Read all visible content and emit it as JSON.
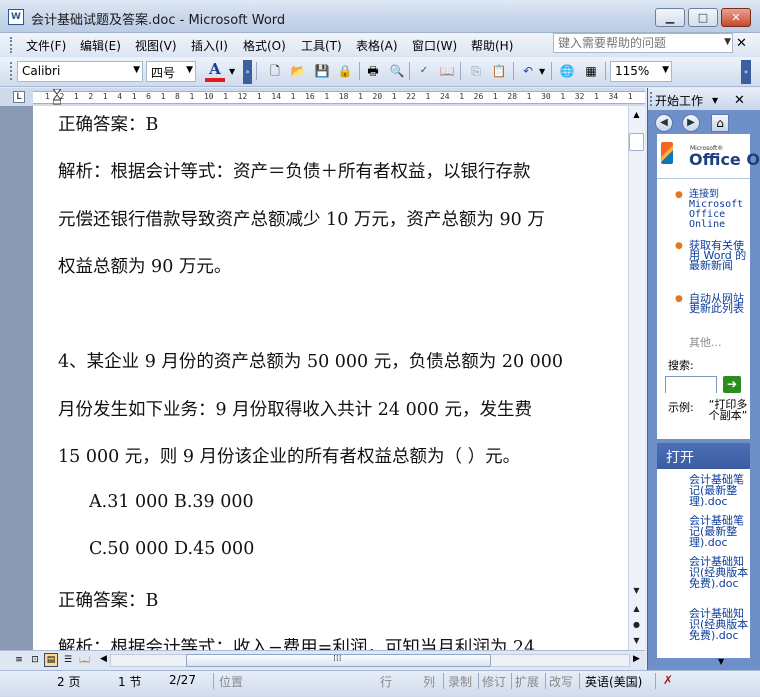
{
  "window": {
    "title": "会计基础试题及答案.doc - Microsoft Word",
    "app_icon": "W"
  },
  "menu": [
    "文件(F)",
    "编辑(E)",
    "视图(V)",
    "插入(I)",
    "格式(O)",
    "工具(T)",
    "表格(A)",
    "窗口(W)",
    "帮助(H)"
  ],
  "help_box": {
    "placeholder": "键入需要帮助的问题"
  },
  "toolbar": {
    "font_name": "Calibri",
    "font_size": "四号",
    "font_color_letter": "A",
    "font_color": "#e21b1b",
    "zoom": "115%"
  },
  "ruler": {
    "labels": "1  2  1  2  1  4  1  6  1  8  1  10  1  12  1  14  1  16  1  18  1  20  1  22  1  24  1  26  1  28  1  30  1  32  1  34  1"
  },
  "document": {
    "lines": [
      "正确答案：B",
      "解析：根据会计等式：资产＝负债＋所有者权益，以银行存款",
      "元偿还银行借款导致资产总额减少 10 万元，资产总额为 90 万",
      "权益总额为 90 万元。",
      "",
      "4、某企业 9 月份的资产总额为 50 000 元，负债总额为 20 000",
      "月份发生如下业务：9 月份取得收入共计 24  000 元，发生费",
      "15 000 元，则 9 月份该企业的所有者权益总额为（  ）元。",
      "A.31 000 B.39 000",
      "C.50 000 D.45 000",
      "正确答案：B",
      "解析：根据会计等式：收入−费用=利润，可知当月利润为 24"
    ]
  },
  "status": {
    "page": "2 页",
    "section": "1 节",
    "page_of": "2/27",
    "position": "位置",
    "line": "行",
    "column": "列",
    "rec": "录制",
    "trk": "修订",
    "ext": "扩展",
    "ovr": "改写",
    "language": "英语(美国)"
  },
  "task_pane": {
    "title": "开始工作",
    "office_small": "Microsoft®",
    "office_brand": "Office O",
    "links": [
      "连接到 Microsoft Office Online",
      "获取有关使用 Word 的最新新闻",
      "自动从网站更新此列表"
    ],
    "more": "其他...",
    "search_label": "搜索:",
    "example_label": "示例:",
    "example_text": "“打印多个副本”",
    "open_title": "打开",
    "recent_files": [
      "会计基础笔记(最新整理).doc",
      "会计基础笔记(最新整理).doc",
      "会计基础知识(经典版本免费).doc",
      "会计基础知识(经典版本免费).doc"
    ]
  },
  "colors": {
    "accent": "#2b579a",
    "pane_blue": "#6f8fc8",
    "close_red": "#c8492d"
  }
}
